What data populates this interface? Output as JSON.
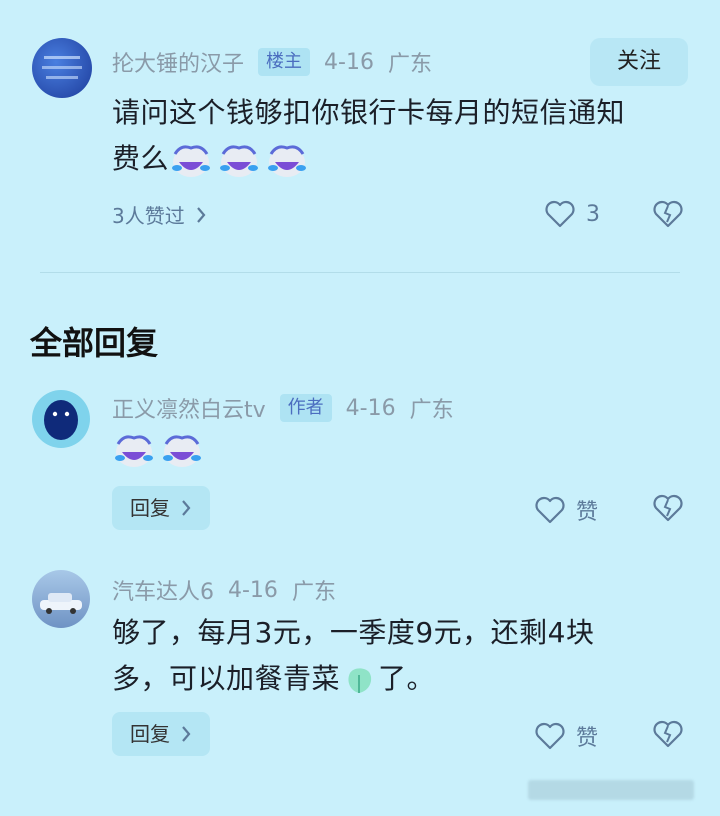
{
  "top_comment": {
    "user": "抡大锤的汉子",
    "badge": "楼主",
    "date": "4-16",
    "location": "广东",
    "follow_label": "关注",
    "text_line1": "请问这个钱够扣你银行卡每月的短信通知",
    "text_line2": "费么",
    "likes_summary": "3人赞过",
    "like_count": "3"
  },
  "section_title": "全部回复",
  "replies": [
    {
      "user": "正义凛然白云tv",
      "badge": "作者",
      "date": "4-16",
      "location": "广东",
      "reply_label": "回复",
      "like_label": "赞"
    },
    {
      "user": "汽车达人6",
      "date": "4-16",
      "location": "广东",
      "text_line1": "够了，每月3元，一季度9元，还剩4块",
      "text_line2_a": "多，可以加餐青菜",
      "text_line2_b": "了。",
      "reply_label": "回复",
      "like_label": "赞"
    }
  ],
  "colors": {
    "background": "#c9f0fb",
    "badge_text": "#4b6dbf"
  },
  "icons": [
    "laughing-crying-emoji-icon",
    "heart-icon",
    "broken-heart-icon",
    "chevron-right-icon",
    "vegetable-emoji-icon"
  ]
}
